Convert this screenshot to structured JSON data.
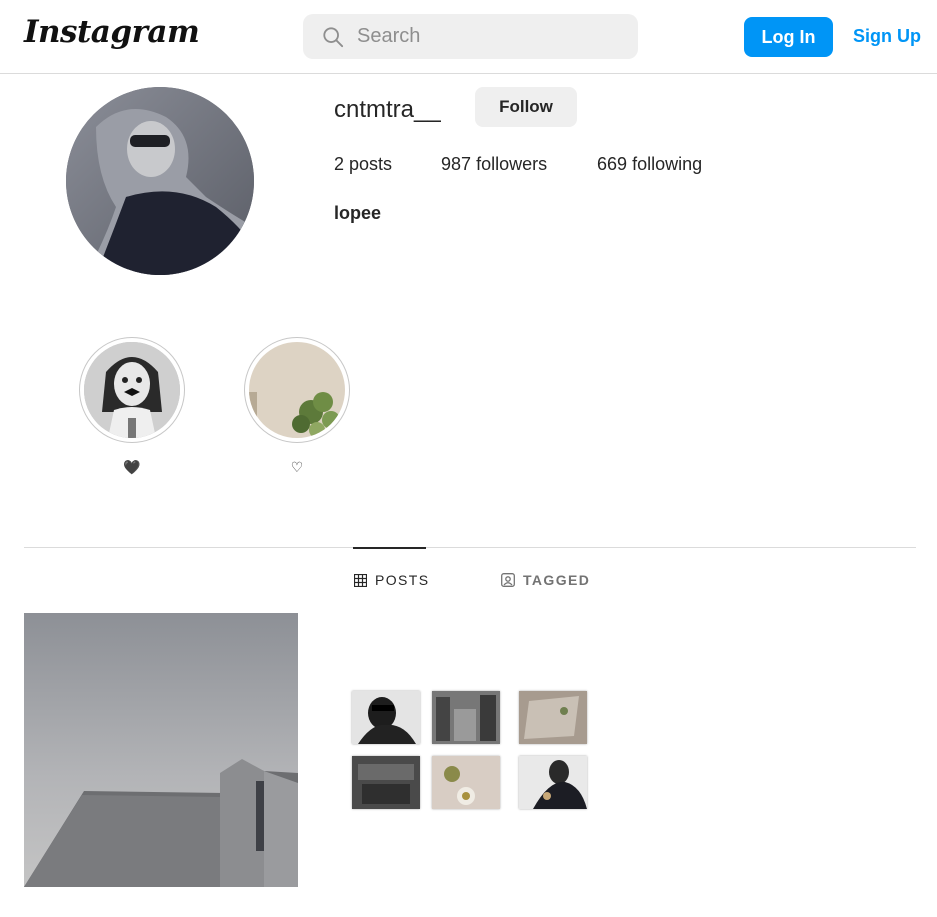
{
  "header": {
    "logo_text": "Instagram",
    "search_placeholder": "Search",
    "login_label": "Log In",
    "signup_label": "Sign Up"
  },
  "profile": {
    "username": "cntmtra__",
    "follow_label": "Follow",
    "posts_count": "2",
    "posts_label": "posts",
    "followers_count": "987",
    "followers_label": "followers",
    "following_count": "669",
    "following_label": "following",
    "bio": "lopee"
  },
  "highlights": [
    {
      "label": "🖤"
    },
    {
      "label": "♡"
    }
  ],
  "tabs": [
    {
      "label": "POSTS",
      "icon": "grid-icon",
      "active": true
    },
    {
      "label": "TAGGED",
      "icon": "tagged-icon",
      "active": false
    }
  ],
  "colors": {
    "brand_blue": "#0095f6",
    "button_gray": "#efefef",
    "divider": "#dbdbdb"
  }
}
